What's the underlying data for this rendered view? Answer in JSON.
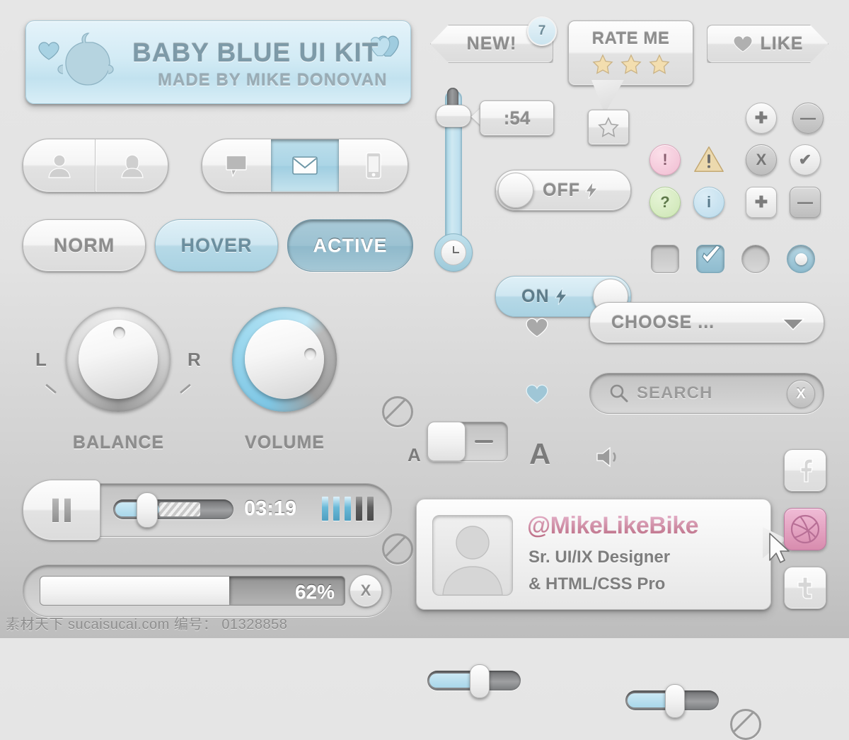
{
  "banner": {
    "title": "BABY BLUE UI KIT",
    "subtitle": "MADE BY MIKE DONOVAN"
  },
  "top_buttons": {
    "new_label": "NEW!",
    "new_badge_count": "7",
    "rate_label": "RATE ME",
    "rate_stars": 3,
    "like_label": "LIKE"
  },
  "state_buttons": {
    "norm": "NORM",
    "hover": "HOVER",
    "active": "ACTIVE"
  },
  "user_pill": {
    "male_icon": "user-male-icon",
    "female_icon": "user-female-icon"
  },
  "segmented": {
    "items": [
      {
        "icon": "chat-bubble-icon",
        "active": false
      },
      {
        "icon": "envelope-icon",
        "active": true
      },
      {
        "icon": "mobile-phone-icon",
        "active": false
      }
    ]
  },
  "vertical_slider": {
    "tooltip_value": ":54",
    "bottom_icon": "clock-icon"
  },
  "toggles": {
    "off_label": "OFF",
    "on_label": "ON",
    "bolt_icon": "lightning-bolt-icon"
  },
  "status_icons": {
    "row1": [
      {
        "name": "plus-circle-icon",
        "glyph": "✚",
        "style": "grey"
      },
      {
        "name": "minus-circle-icon",
        "glyph": "—",
        "style": "greyd"
      }
    ],
    "row2": [
      {
        "name": "error-circle-icon",
        "glyph": "!",
        "style": "pink"
      },
      {
        "name": "warning-triangle-icon",
        "glyph": "!",
        "style": "warn"
      },
      {
        "name": "close-circle-icon",
        "glyph": "X",
        "style": "greyd"
      },
      {
        "name": "check-circle-icon",
        "glyph": "✔",
        "style": "grey"
      }
    ],
    "row3": [
      {
        "name": "help-circle-icon",
        "glyph": "?",
        "style": "green"
      },
      {
        "name": "info-circle-icon",
        "glyph": "i",
        "style": "blue"
      },
      {
        "name": "plus-square-icon",
        "glyph": "✚",
        "style": "grey"
      },
      {
        "name": "minus-square-icon",
        "glyph": "—",
        "style": "greyd"
      }
    ]
  },
  "form_controls": {
    "checkbox_unchecked": "checkbox-unchecked",
    "checkbox_checked": "checkbox-checked",
    "radio_unselected": "radio-unselected",
    "radio_selected": "radio-selected"
  },
  "knobs": [
    {
      "name": "balance-knob",
      "label": "BALANCE",
      "left_mark": "L",
      "right_mark": "R",
      "value_deg": 0
    },
    {
      "name": "volume-knob",
      "label": "VOLUME",
      "value_deg": 120
    }
  ],
  "mini_toggles": [
    {
      "state": "off",
      "disabled_icon": "no-entry-icon",
      "heart_icon": "heart-icon-grey"
    },
    {
      "state": "on",
      "disabled_icon": "no-entry-icon",
      "heart_icon": "heart-icon-blue"
    }
  ],
  "dropdown": {
    "label": "CHOOSE ...",
    "caret_icon": "chevron-down-icon"
  },
  "search": {
    "placeholder": "SEARCH",
    "search_icon": "magnifier-icon",
    "clear_icon": "clear-x-icon"
  },
  "sliders": [
    {
      "name": "font-size-slider",
      "left_icon": "small-a-letter",
      "left_text": "A",
      "right_icon": "large-a-letter",
      "right_text": "A",
      "percent": 55
    },
    {
      "name": "volume-slider",
      "left_icon": "speaker-icon",
      "right_icon": "no-entry-icon",
      "percent": 52
    }
  ],
  "player": {
    "play_pause_icon": "pause-icon",
    "time": "03:19",
    "progress_percent": 36,
    "buffer_percent": 70,
    "eq_bars": [
      true,
      true,
      true,
      false,
      false
    ]
  },
  "progress": {
    "percent_label": "62%",
    "percent_value": 62,
    "cancel_icon": "cancel-x-icon"
  },
  "profile_card": {
    "handle": "@MikeLikeBike",
    "line1": "Sr. UI/IX Designer",
    "line2": "& HTML/CSS Pro",
    "avatar_icon": "user-silhouette-icon"
  },
  "social": [
    {
      "name": "facebook-icon",
      "tint": "grey"
    },
    {
      "name": "dribbble-icon",
      "tint": "pink"
    },
    {
      "name": "twitter-icon",
      "tint": "grey"
    }
  ],
  "watermark": "素材天下 sucaisucai.com  编号： 01328858",
  "colors": {
    "accent_blue": "#a9d2e2",
    "accent_blue_dark": "#8fb9cb",
    "pink": "#d88cae",
    "bg": "#e3e3e3"
  }
}
